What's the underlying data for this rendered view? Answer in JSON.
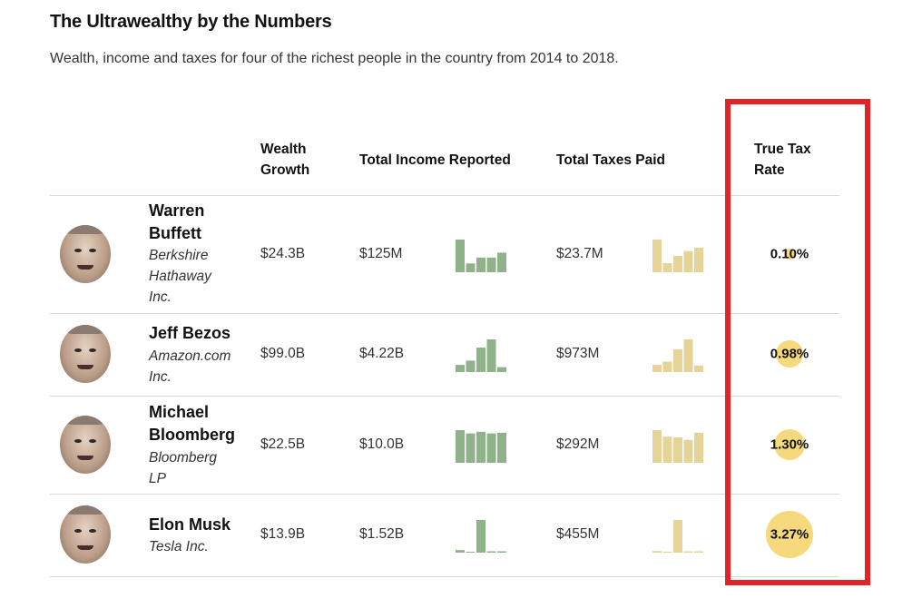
{
  "title": "The Ultrawealthy by the Numbers",
  "subtitle": "Wealth, income and taxes for four of the richest people in the country from 2014 to 2018.",
  "columns": {
    "wealth_growth": "Wealth Growth",
    "income": "Total Income Reported",
    "taxes": "Total Taxes Paid",
    "true_tax_rate": "True Tax Rate"
  },
  "colors": {
    "income_bars": "#8fb28a",
    "tax_bars": "#e5d398",
    "rate_circle": "#f5d97c",
    "highlight_box": "#e0242a"
  },
  "chart_data": {
    "type": "table",
    "rows": [
      {
        "name_lines": [
          "Warren",
          "Buffett"
        ],
        "company_lines": [
          "Berkshire",
          "Hathaway",
          "Inc."
        ],
        "wealth_growth": "$24.3B",
        "income": "$125M",
        "taxes": "$23.7M",
        "true_tax_rate": "0.10%",
        "rate_value": 0.1,
        "income_bars": [
          1.0,
          0.27,
          0.45,
          0.45,
          0.6
        ],
        "tax_bars": [
          1.0,
          0.28,
          0.5,
          0.65,
          0.75
        ]
      },
      {
        "name_lines": [
          "Jeff Bezos"
        ],
        "company_lines": [
          "Amazon.com",
          "Inc."
        ],
        "wealth_growth": "$99.0B",
        "income": "$4.22B",
        "taxes": "$973M",
        "true_tax_rate": "0.98%",
        "rate_value": 0.98,
        "income_bars": [
          0.22,
          0.35,
          0.75,
          1.0,
          0.15
        ],
        "tax_bars": [
          0.22,
          0.32,
          0.7,
          1.0,
          0.2
        ]
      },
      {
        "name_lines": [
          "Michael",
          "Bloomberg"
        ],
        "company_lines": [
          "Bloomberg",
          "LP"
        ],
        "wealth_growth": "$22.5B",
        "income": "$10.0B",
        "taxes": "$292M",
        "true_tax_rate": "1.30%",
        "rate_value": 1.3,
        "income_bars": [
          1.0,
          0.9,
          0.95,
          0.9,
          0.92
        ],
        "tax_bars": [
          1.0,
          0.8,
          0.78,
          0.7,
          0.92
        ]
      },
      {
        "name_lines": [
          "Elon Musk"
        ],
        "company_lines": [
          "Tesla Inc."
        ],
        "wealth_growth": "$13.9B",
        "income": "$1.52B",
        "taxes": "$455M",
        "true_tax_rate": "3.27%",
        "rate_value": 3.27,
        "income_bars": [
          0.08,
          0.0,
          1.0,
          0.03,
          0.03
        ],
        "tax_bars": [
          0.05,
          0.0,
          1.0,
          0.03,
          0.03
        ]
      }
    ]
  }
}
